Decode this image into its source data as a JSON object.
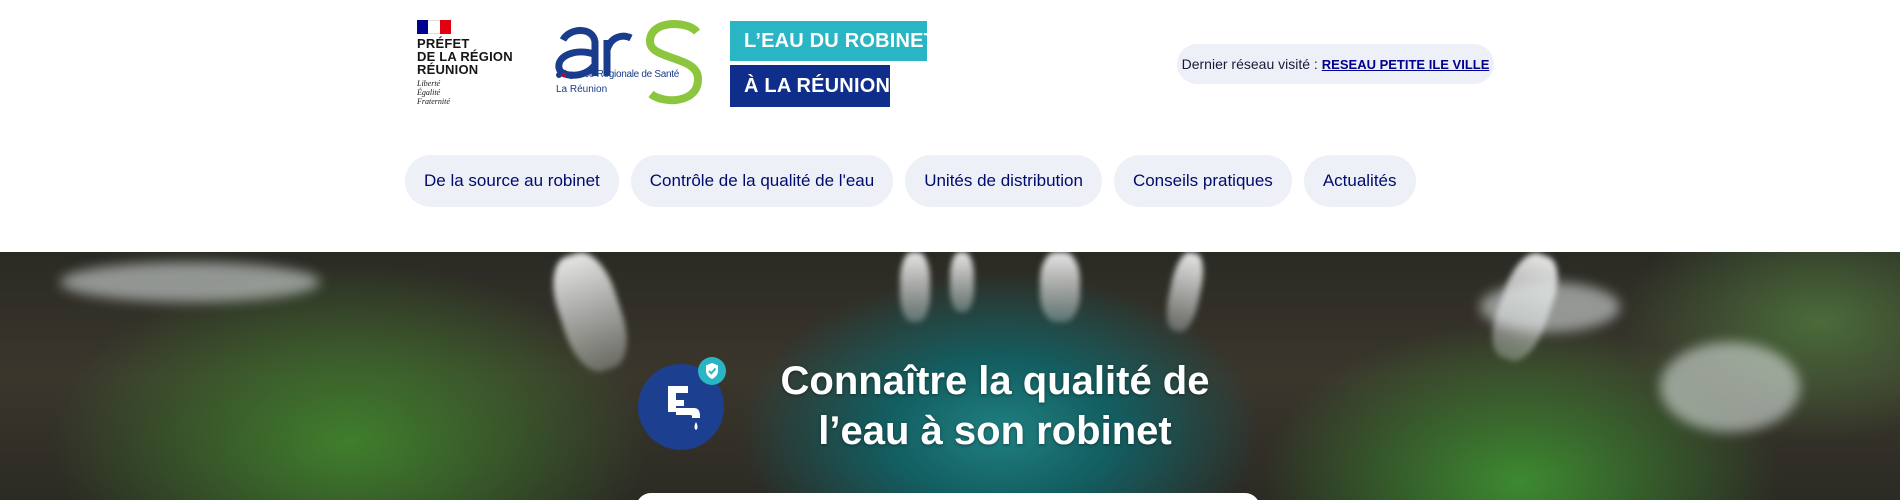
{
  "header": {
    "prefet": {
      "title_lines": [
        "PRÉFET",
        "DE LA RÉGION",
        "RÉUNION"
      ],
      "motto_lines": [
        "Liberté",
        "Égalité",
        "Fraternité"
      ]
    },
    "ars": {
      "logo_text": "ars",
      "subtitle": "Agence Régionale de Santé",
      "region": "La Réunion"
    },
    "site_title": {
      "line1": "L’EAU DU ROBINET",
      "line2": "À LA RÉUNION"
    },
    "last_network": {
      "label": "Dernier réseau visité :",
      "value": "RESEAU PETITE ILE VILLE"
    }
  },
  "nav": {
    "items": [
      {
        "label": "De la source au robinet"
      },
      {
        "label": "Contrôle de la qualité de l'eau"
      },
      {
        "label": "Unités de distribution"
      },
      {
        "label": "Conseils pratiques"
      },
      {
        "label": "Actualités"
      }
    ]
  },
  "hero": {
    "title_line1": "Connaître la qualité de",
    "title_line2": "l’eau à son robinet",
    "icon": "faucet-icon",
    "badge_icon": "shield-check-icon"
  },
  "colors": {
    "navy": "#000091",
    "teal": "#2ab5c4",
    "dark_blue": "#0f2d8a",
    "ars_green": "#8cc63f",
    "pill_bg": "#eef0f7"
  }
}
